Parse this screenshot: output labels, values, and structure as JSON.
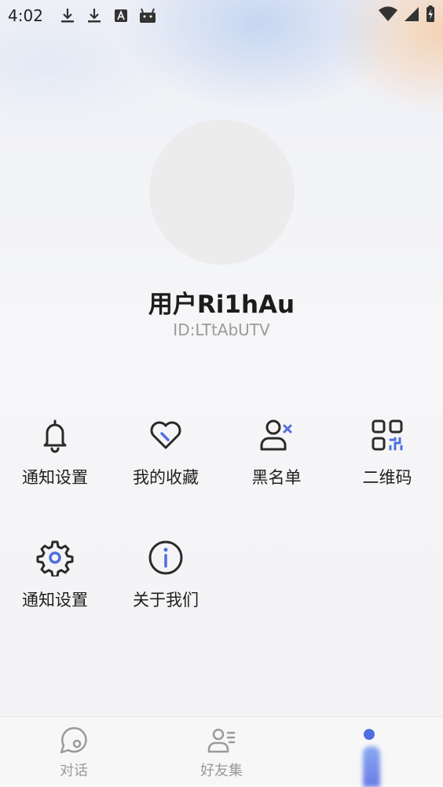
{
  "status_bar": {
    "time": "4:02",
    "left_icons": [
      "download-icon",
      "download-icon",
      "translate-a-icon",
      "android-icon"
    ],
    "right_icons": [
      "wifi-icon",
      "cellular-icon",
      "battery-charging-icon"
    ]
  },
  "profile": {
    "name": "用户Ri1hAu",
    "id": "ID:LTtAbUTV"
  },
  "menu": [
    {
      "label": "通知设置",
      "icon": "bell-icon"
    },
    {
      "label": "我的收藏",
      "icon": "heart-icon"
    },
    {
      "label": "黑名单",
      "icon": "user-block-icon"
    },
    {
      "label": "二维码",
      "icon": "qr-code-icon"
    },
    {
      "label": "通知设置",
      "icon": "gear-icon"
    },
    {
      "label": "关于我们",
      "icon": "info-icon"
    }
  ],
  "bottom_nav": [
    {
      "label": "对话",
      "icon": "chat-icon"
    },
    {
      "label": "好友集",
      "icon": "friends-icon"
    },
    {
      "label": "",
      "icon": "profile-icon",
      "active": true
    }
  ],
  "colors": {
    "accent": "#4f6fe0",
    "icon_stroke": "#2a2a2a"
  }
}
